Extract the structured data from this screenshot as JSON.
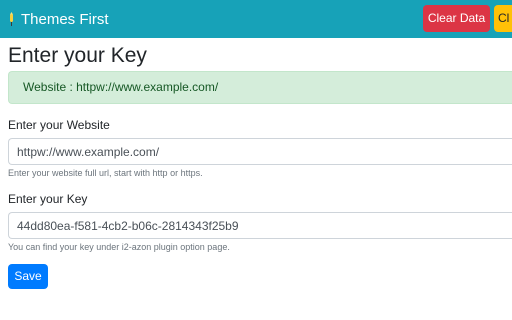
{
  "navbar": {
    "brand_icon": "rocket-icon",
    "brand_text": "Themes First",
    "clear_button_label": "Clear Data",
    "second_button_label": "Cl",
    "colors": {
      "navbar_bg": "#17a2b8",
      "clear_button_bg": "#dc3545",
      "second_button_bg": "#ffc107"
    }
  },
  "page": {
    "title": "Enter your Key"
  },
  "alert": {
    "text": "Website : httpw://www.example.com/",
    "color": "#d4edda"
  },
  "form": {
    "website": {
      "label": "Enter your Website",
      "value": "httpw://www.example.com/",
      "help": "Enter your website full url, start with http or https."
    },
    "key": {
      "label": "Enter your Key",
      "value": "44dd80ea-f581-4cb2-b06c-2814343f25b9",
      "help": "You can find your key under i2-azon plugin option page."
    },
    "save_label": "Save",
    "save_color": "#007bff"
  }
}
